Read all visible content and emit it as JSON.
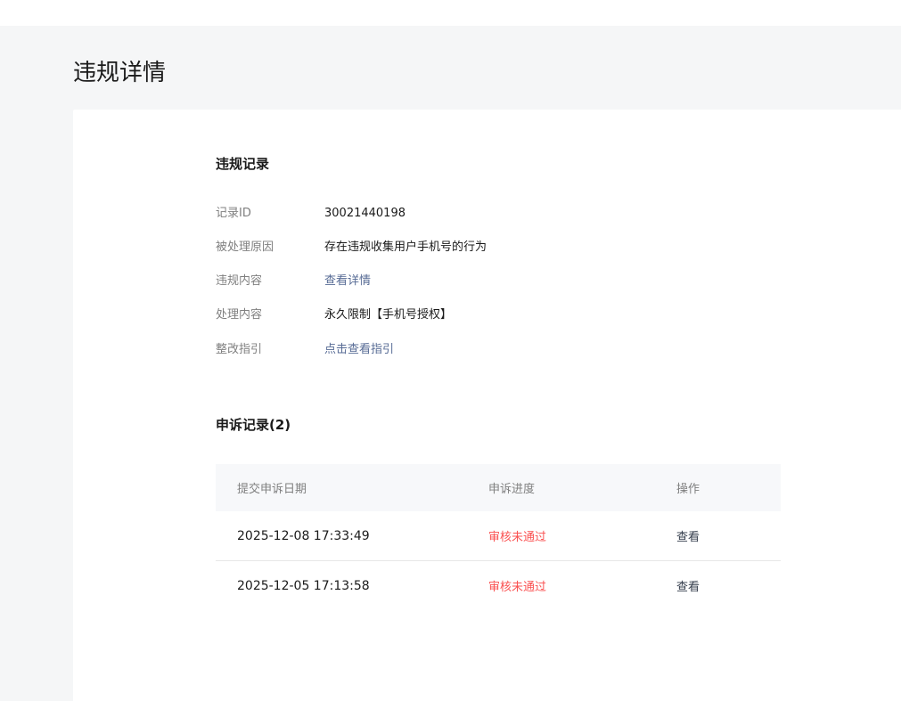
{
  "page": {
    "title": "违规详情"
  },
  "violation_record": {
    "section_title": "违规记录",
    "fields": [
      {
        "label": "记录ID",
        "value": "30021440198"
      },
      {
        "label": "被处理原因",
        "value": "存在违规收集用户手机号的行为"
      },
      {
        "label": "违规内容",
        "value": "查看详情"
      },
      {
        "label": "处理内容",
        "value": "永久限制【手机号授权】"
      },
      {
        "label": "整改指引",
        "value": "点击查看指引"
      }
    ]
  },
  "appeal_record": {
    "section_title": "申诉记录(2)",
    "columns": [
      "提交申诉日期",
      "申诉进度",
      "操作"
    ],
    "rows": [
      {
        "date": "2025-12-08 17:33:49",
        "status": "审核未通过",
        "action": "查看"
      },
      {
        "date": "2025-12-05 17:13:58",
        "status": "审核未通过",
        "action": "查看"
      }
    ]
  },
  "colors": {
    "link": "#576b95",
    "status_fail": "#fa5151",
    "page_background": "#f5f6f7",
    "card_background": "#ffffff"
  }
}
